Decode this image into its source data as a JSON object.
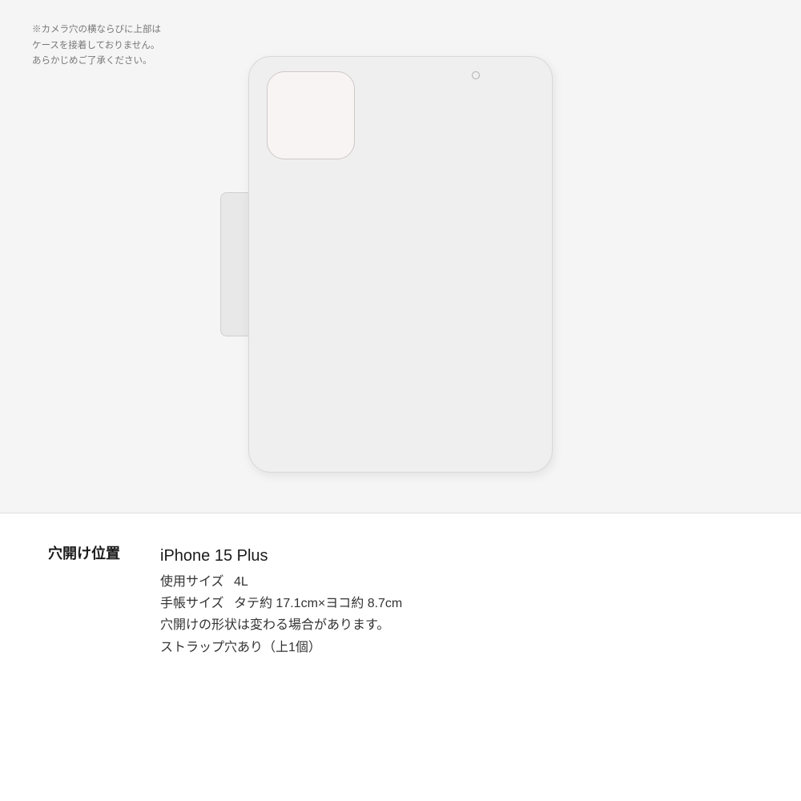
{
  "case": {
    "warning_text": "※カメラ穴の横ならびに上部は\nケースを接着しておりません。\nあらかじめご了承ください。"
  },
  "info": {
    "hole_position_label": "穴開け位置",
    "model_name": "iPhone 15 Plus",
    "size_label": "使用サイズ",
    "size_value": "4L",
    "notebook_size_label": "手帳サイズ",
    "notebook_size_value": "タテ約 17.1cm×ヨコ約 8.7cm",
    "hole_shape_label": "穴開けの形状は変わる場合があります。",
    "strap_label": "ストラップ穴あり（上1個）"
  }
}
